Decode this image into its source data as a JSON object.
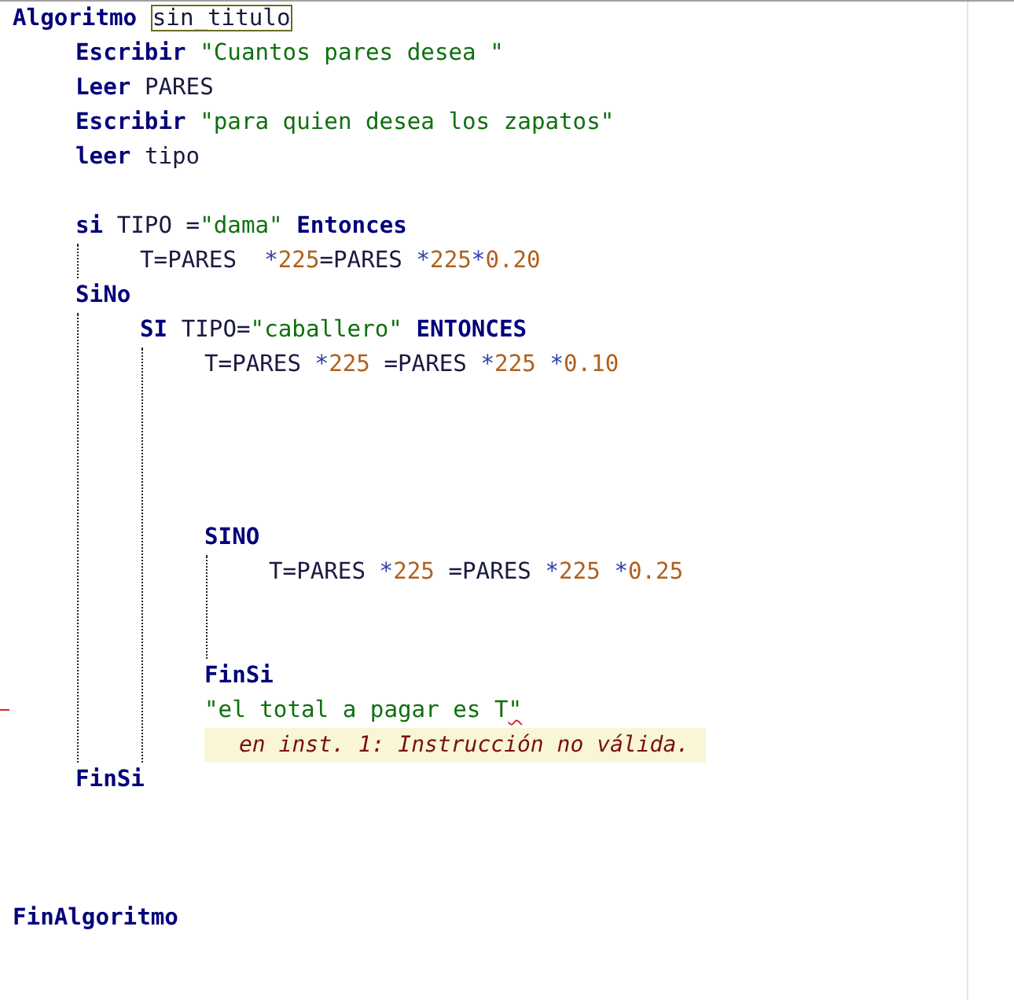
{
  "editor": {
    "lines": [
      {
        "kind": "code",
        "tokens": [
          {
            "kind": "keyword",
            "text": "Algoritmo "
          },
          {
            "kind": "name",
            "text": "sin_titulo"
          }
        ],
        "children": [
          {
            "kind": "code",
            "tokens": [
              {
                "kind": "keyword",
                "text": "Escribir"
              },
              {
                "kind": "string",
                "text": " \"Cuantos pares desea \""
              }
            ]
          },
          {
            "kind": "code",
            "tokens": [
              {
                "kind": "keyword",
                "text": "Leer"
              },
              {
                "kind": "plain",
                "text": " PARES"
              }
            ]
          },
          {
            "kind": "code",
            "tokens": [
              {
                "kind": "keyword",
                "text": "Escribir"
              },
              {
                "kind": "string",
                "text": " \"para quien desea los zapatos\""
              }
            ]
          },
          {
            "kind": "code",
            "tokens": [
              {
                "kind": "keyword",
                "text": "leer"
              },
              {
                "kind": "plain",
                "text": " tipo"
              }
            ]
          },
          {
            "kind": "blank"
          },
          {
            "kind": "code",
            "tokens": [
              {
                "kind": "keyword",
                "text": "si"
              },
              {
                "kind": "plain",
                "text": " TIPO ="
              },
              {
                "kind": "string",
                "text": "\"dama\""
              },
              {
                "kind": "keyword",
                "text": " Entonces"
              }
            ],
            "children": [
              {
                "kind": "code",
                "tokens": [
                  {
                    "kind": "plain",
                    "text": "T=PARES  "
                  },
                  {
                    "kind": "operator",
                    "text": "*"
                  },
                  {
                    "kind": "number",
                    "text": "225"
                  },
                  {
                    "kind": "plain",
                    "text": "=PARES "
                  },
                  {
                    "kind": "operator",
                    "text": "*"
                  },
                  {
                    "kind": "number",
                    "text": "225"
                  },
                  {
                    "kind": "operator",
                    "text": "*"
                  },
                  {
                    "kind": "number",
                    "text": "0.20"
                  }
                ]
              }
            ]
          },
          {
            "kind": "code",
            "tokens": [
              {
                "kind": "keyword",
                "text": "SiNo"
              }
            ],
            "children": [
              {
                "kind": "code",
                "tokens": [
                  {
                    "kind": "keyword",
                    "text": "SI"
                  },
                  {
                    "kind": "plain",
                    "text": " TIPO="
                  },
                  {
                    "kind": "string",
                    "text": "\"caballero\""
                  },
                  {
                    "kind": "keyword",
                    "text": " ENTONCES"
                  }
                ],
                "children": [
                  {
                    "kind": "code",
                    "tokens": [
                      {
                        "kind": "plain",
                        "text": "T=PARES "
                      },
                      {
                        "kind": "operator",
                        "text": "*"
                      },
                      {
                        "kind": "number",
                        "text": "225"
                      },
                      {
                        "kind": "plain",
                        "text": " =PARES "
                      },
                      {
                        "kind": "operator",
                        "text": "*"
                      },
                      {
                        "kind": "number",
                        "text": "225"
                      },
                      {
                        "kind": "operator",
                        "text": " *"
                      },
                      {
                        "kind": "number",
                        "text": "0.10"
                      }
                    ]
                  },
                  {
                    "kind": "blank"
                  },
                  {
                    "kind": "blank"
                  },
                  {
                    "kind": "blank"
                  },
                  {
                    "kind": "blank"
                  },
                  {
                    "kind": "code",
                    "tokens": [
                      {
                        "kind": "keyword",
                        "text": "SINO"
                      }
                    ],
                    "children": [
                      {
                        "kind": "code",
                        "tokens": [
                          {
                            "kind": "plain",
                            "text": "T=PARES "
                          },
                          {
                            "kind": "operator",
                            "text": "*"
                          },
                          {
                            "kind": "number",
                            "text": "225"
                          },
                          {
                            "kind": "plain",
                            "text": " =PARES "
                          },
                          {
                            "kind": "operator",
                            "text": "*"
                          },
                          {
                            "kind": "number",
                            "text": "225"
                          },
                          {
                            "kind": "operator",
                            "text": " *"
                          },
                          {
                            "kind": "number",
                            "text": "0.25"
                          }
                        ]
                      },
                      {
                        "kind": "blank"
                      },
                      {
                        "kind": "blank"
                      }
                    ]
                  },
                  {
                    "kind": "code",
                    "tokens": [
                      {
                        "kind": "keyword",
                        "text": "FinSi"
                      }
                    ]
                  },
                  {
                    "kind": "code",
                    "tokens": [
                      {
                        "kind": "string",
                        "text": "\"el total a pagar es T"
                      },
                      {
                        "kind": "flagged",
                        "text": "\""
                      }
                    ],
                    "error": "en inst. 1: Instrucción no válida."
                  }
                ]
              }
            ]
          },
          {
            "kind": "code",
            "tokens": [
              {
                "kind": "keyword",
                "text": "FinSi"
              }
            ]
          },
          {
            "kind": "blank"
          },
          {
            "kind": "blank"
          },
          {
            "kind": "blank"
          }
        ]
      },
      {
        "kind": "code",
        "tokens": [
          {
            "kind": "keyword",
            "text": "FinAlgoritmo"
          }
        ]
      }
    ]
  }
}
